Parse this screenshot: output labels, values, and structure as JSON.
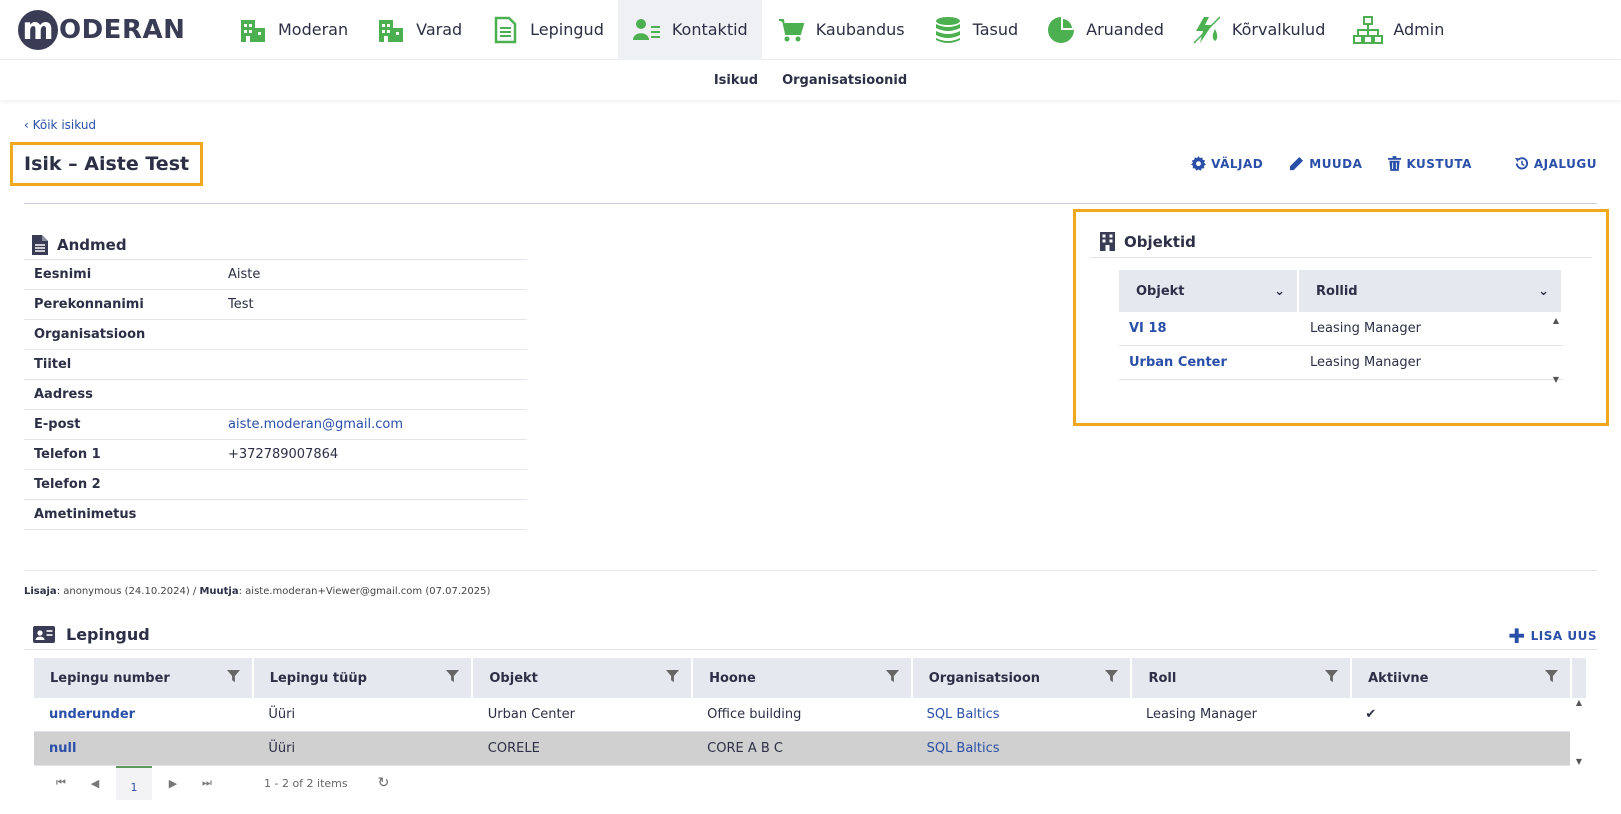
{
  "brand": {
    "logo_letter": "m",
    "logo_text": "ODERAN",
    "accent": "#4caf50",
    "dark": "#3a3c55",
    "highlight": "#f0a91c"
  },
  "nav": [
    {
      "label": "Moderan",
      "icon": "building-icon"
    },
    {
      "label": "Varad",
      "icon": "building-icon"
    },
    {
      "label": "Lepingud",
      "icon": "document-icon"
    },
    {
      "label": "Kontaktid",
      "icon": "contacts-icon",
      "active": true
    },
    {
      "label": "Kaubandus",
      "icon": "cart-icon"
    },
    {
      "label": "Tasud",
      "icon": "coins-icon"
    },
    {
      "label": "Aruanded",
      "icon": "pie-chart-icon"
    },
    {
      "label": "Kõrvalkulud",
      "icon": "utilities-icon"
    },
    {
      "label": "Admin",
      "icon": "sitemap-icon"
    }
  ],
  "subnav": [
    "Isikud",
    "Organisatsioonid"
  ],
  "breadcrumb": "‹ Kõik isikud",
  "page_title": "Isik – Aiste Test",
  "actions": {
    "fields": "VÄLJAD",
    "edit": "MUUDA",
    "delete": "KUSTUTA",
    "history": "AJALUGU"
  },
  "andmed": {
    "title": "Andmed",
    "rows": [
      {
        "label": "Eesnimi",
        "value": "Aiste"
      },
      {
        "label": "Perekonnanimi",
        "value": "Test"
      },
      {
        "label": "Organisatsioon",
        "value": ""
      },
      {
        "label": "Tiitel",
        "value": ""
      },
      {
        "label": "Aadress",
        "value": ""
      },
      {
        "label": "E-post",
        "value": "aiste.moderan@gmail.com"
      },
      {
        "label": "Telefon 1",
        "value": "+372789007864"
      },
      {
        "label": "Telefon 2",
        "value": ""
      },
      {
        "label": "Ametinimetus",
        "value": ""
      }
    ]
  },
  "objektid": {
    "title": "Objektid",
    "columns": [
      "Objekt",
      "Rollid"
    ],
    "rows": [
      {
        "objekt": "VI 18",
        "rollid": "Leasing Manager"
      },
      {
        "objekt": "Urban Center",
        "rollid": "Leasing Manager"
      }
    ]
  },
  "meta": {
    "added_label": "Lisaja",
    "added_value": ": anonymous (24.10.2024) / ",
    "modified_label": "Muutja",
    "modified_value": ": aiste.moderan+Viewer@gmail.com (07.07.2025)"
  },
  "lepingud": {
    "title": "Lepingud",
    "add_label": "LISA UUS",
    "columns": [
      "Lepingu number",
      "Lepingu tüüp",
      "Objekt",
      "Hoone",
      "Organisatsioon",
      "Roll",
      "Aktiivne"
    ],
    "rows": [
      [
        "underunder",
        "Üüri",
        "Urban Center",
        "Office building",
        "SQL Baltics",
        "Leasing Manager",
        "✔"
      ],
      [
        "null",
        "Üüri",
        "CORELE",
        "CORE A B C",
        "SQL Baltics",
        "",
        ""
      ]
    ]
  },
  "pager": {
    "page": "1",
    "info": "1 - 2 of 2 items"
  }
}
